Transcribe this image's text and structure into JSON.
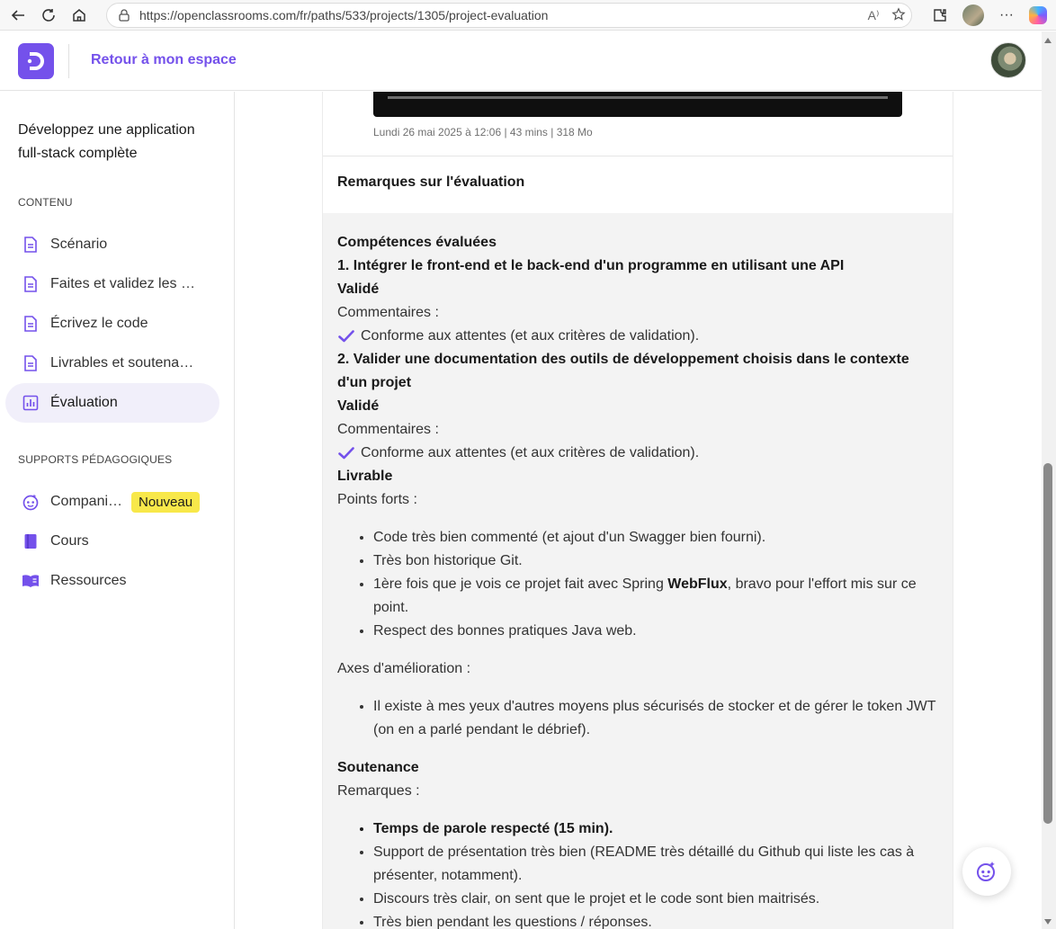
{
  "browser": {
    "url": "https://openclassrooms.com/fr/paths/533/projects/1305/project-evaluation",
    "read_aloud_label": "A⁾",
    "more_label": "···"
  },
  "header": {
    "back_label": "Retour à mon espace"
  },
  "sidebar": {
    "course_title": "Développez une application full-stack complète",
    "content_label": "CONTENU",
    "content_items": [
      {
        "label": "Scénario",
        "icon": "document-icon"
      },
      {
        "label": "Faites et validez les …",
        "icon": "document-icon"
      },
      {
        "label": "Écrivez le code",
        "icon": "document-icon"
      },
      {
        "label": "Livrables et soutena…",
        "icon": "document-icon"
      },
      {
        "label": "Évaluation",
        "icon": "chart-icon"
      }
    ],
    "supports_label": "SUPPORTS PÉDAGOGIQUES",
    "support_items": [
      {
        "label": "Compani…",
        "icon": "robot-icon",
        "badge": "Nouveau"
      },
      {
        "label": "Cours",
        "icon": "book-icon"
      },
      {
        "label": "Ressources",
        "icon": "open-book-icon"
      }
    ]
  },
  "main": {
    "video_meta": "Lundi 26 mai 2025 à 12:06 | 43 mins | 318 Mo",
    "remarks_title": "Remarques sur l'évaluation",
    "competences_title": "Compétences évaluées",
    "comp1_title": "1. Intégrer le front-end et le back-end d'un programme en utilisant une API",
    "comp1_status": "Validé",
    "comp1_comments_label": "Commentaires :",
    "comp1_comment": "Conforme aux attentes (et aux critères de validation).",
    "comp2_title_line1": "2. Valider une documentation des outils de développement choisis dans le contexte",
    "comp2_title_line2": "d'un projet",
    "comp2_status": "Validé",
    "comp2_comments_label": "Commentaires :",
    "comp2_comment": "Conforme aux attentes (et aux critères de validation).",
    "livrable_title": "Livrable",
    "strengths_label": "Points forts :",
    "strengths": [
      "Code très bien commenté (et ajout d'un Swagger bien fourni).",
      "Très bon historique Git."
    ],
    "strength3_before": "1ère fois que je vois ce projet fait avec Spring ",
    "strength3_bold": "WebFlux",
    "strength3_after": ", bravo pour l'effort mis sur ce point.",
    "strength4": "Respect des bonnes pratiques Java web.",
    "improve_label": "Axes d'amélioration :",
    "improvements": [
      "Il existe à mes yeux d'autres moyens plus sécurisés de stocker et de gérer le token JWT (on en a parlé pendant le débrief)."
    ],
    "soutenance_title": "Soutenance",
    "soutenance_label": "Remarques :",
    "soutenance_bold": "Temps de parole respecté (15 min).",
    "soutenance_items": [
      "Support de présentation très bien (README très détaillé du Github qui liste les cas à présenter, notamment).",
      "Discours très clair, on sent que le projet et le code sont bien maitrisés.",
      "Très bien pendant les questions / réponses."
    ]
  },
  "colors": {
    "brand": "#7451eb",
    "badge": "#f8e84a",
    "active_bg": "#f1effa",
    "panel_bg": "#f3f3f3"
  }
}
